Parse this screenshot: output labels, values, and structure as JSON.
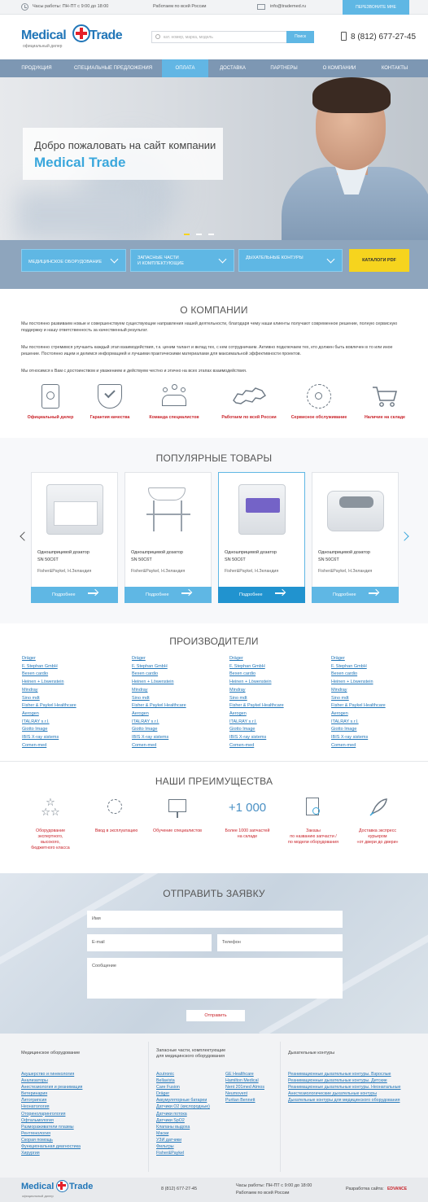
{
  "topbar": {
    "hours": "Часы работы: ПН-ПТ с 9:00 до 18:00",
    "region": "Работаем по всей России",
    "email": "info@trademed.ru",
    "callback": "Перезвоните мне"
  },
  "header": {
    "logo_word1": "Medical",
    "logo_word2": "Trade",
    "logo_sub": "официальный дилер",
    "search_placeholder": "кат. номер, марка, модель",
    "search_button": "Поиск",
    "phone": "8 (812) 677-27-45"
  },
  "nav": [
    "Продукция",
    "Специальные предложения",
    "Оплата",
    "Доставка",
    "Партнеры",
    "О компании",
    "Контакты"
  ],
  "hero": {
    "welcome": "Добро пожаловать на сайт компании",
    "company": "Medical Trade"
  },
  "categories": [
    {
      "line1": "Медицинское оборудование",
      "line2": ""
    },
    {
      "line1": "Запасные части",
      "line2": "и комплектующие"
    },
    {
      "line1": "Дыхательные контуры",
      "line2": ""
    }
  ],
  "catalog_pdf": "Каталоги PDF",
  "about": {
    "title": "О компании",
    "p1": "Мы постоянно развиваем новые и совершенствуем существующие направления нашей деятельности, благодаря чему наши клиенты получают современное решение, полную сервисную поддержку и нашу ответственность за качественный результат.",
    "p2": "Мы постоянно стремимся улучшить каждый этап взаимодействия, т.к. ценим талант и вклад тех, с кем сотрудничаем. Активно подключаем тех, кто должен быть вовлечен в то или иное решение. Постоянно ищем и делимся информацией и лучшими практическими материалами для максимальной эффективности проектов.",
    "p3": "Мы относимся к Вам с достоинством и уважением и действуем честно и этично на всех этапах взаимодействия."
  },
  "features": [
    "Официальный дилер",
    "Гарантия качества",
    "Команда специалистов",
    "Работаем по всей России",
    "Сервисное обслуживание",
    "Наличие на складе"
  ],
  "popular": {
    "title": "Популярные товары",
    "products": [
      {
        "name1": "Одношприцевой дозатор",
        "name2": "SN 50C6T",
        "brand": "Fisher&Paykel, Н.Зеландия",
        "more": "Подробнее"
      },
      {
        "name1": "Одношприцевой дозатор",
        "name2": "SN 50C6T",
        "brand": "Fisher&Paykel, Н.Зеландия",
        "more": "Подробнее"
      },
      {
        "name1": "Одношприцевой дозатор",
        "name2": "SN 50C6T",
        "brand": "Fisher&Paykel, Н.Зеландия",
        "more": "Подробнее"
      },
      {
        "name1": "Одношприцевой дозатор",
        "name2": "SN 50C6T",
        "brand": "Fisher&Paykel, Н.Зеландия",
        "more": "Подробнее"
      }
    ]
  },
  "manufacturers": {
    "title": "Производители",
    "columns": [
      [
        "Dräger",
        "F. Stephan GmbH",
        "Bexen cardio",
        "Heinen + Löwenstein",
        "Mindray",
        "Sino mdt",
        "Fisher & Paykel Healthcare",
        "Aerogen",
        "ITALRAY s.r.l.",
        "Giotto Image",
        "IBIS X-ray sistems",
        "Comen-med"
      ],
      [
        "Dräger",
        "F. Stephan GmbH",
        "Bexen cardio",
        "Heinen + Löwenstein",
        "Mindray",
        "Sino mdt",
        "Fisher & Paykel Healthcare",
        "Aerogen",
        "ITALRAY s.r.l.",
        "Giotto Image",
        "IBIS X-ray sistems",
        "Comen-med"
      ],
      [
        "Dräger",
        "F. Stephan GmbH",
        "Bexen cardio",
        "Heinen + Löwenstein",
        "Mindray",
        "Sino mdt",
        "Fisher & Paykel Healthcare",
        "Aerogen",
        "ITALRAY s.r.l.",
        "Giotto Image",
        "IBIS X-ray sistems",
        "Comen-med"
      ],
      [
        "Dräger",
        "F. Stephan GmbH",
        "Bexen cardio",
        "Heinen + Löwenstein",
        "Mindray",
        "Sino mdt",
        "Fisher & Paykel Healthcare",
        "Aerogen",
        "ITALRAY s.r.l.",
        "Giotto Image",
        "IBIS X-ray sistems",
        "Comen-med"
      ]
    ]
  },
  "advantages": {
    "title": "Наши преимущества",
    "big_number": "+1 000",
    "items": [
      [
        "Оборудование",
        "экспертного,",
        "высокого,",
        "бюджетного класса"
      ],
      [
        "Ввод в эксплуатацию"
      ],
      [
        "Обучение специалистов"
      ],
      [
        "Более 1000 запчастей",
        "на складе"
      ],
      [
        "Заказы",
        "по названию запчасти /",
        "по модели оборудования"
      ],
      [
        "Доставка экспресс",
        "курьером",
        "«от двери до двери»"
      ]
    ]
  },
  "form": {
    "title": "Отправить заявку",
    "name": "Имя",
    "email": "E-mail",
    "phone": "Телефон",
    "message": "Сообщение",
    "submit": "Отправить"
  },
  "footer": {
    "col1_title": "Медицинское оборудование",
    "col1": [
      "Акушерство и гинекология",
      "Анализаторы",
      "Анестезиология и реанимация",
      "Ветеринария",
      "Литотрипсия",
      "Неонатология",
      "Оториноларингология",
      "Офтальмология",
      "Размораживатели плазмы",
      "Рентгенология",
      "Скорая помощь",
      "Функциональная диагностика",
      "Хирургия"
    ],
    "col2_title1": "Запасные части, комплектующие",
    "col2_title2": "для медицинского оборудования",
    "col2a": [
      "Acutronic",
      "Bellavista",
      "Care Fusion",
      "Dräger",
      "Аккумуляторные батареи",
      "Датчики O2 (кислородные)",
      "Датчики потока",
      "Датчики SpO2",
      "Клапаны выдоха",
      "Маски",
      "УЗИ датчики",
      "Фильтры",
      "Fisher&Paykel"
    ],
    "col2b": [
      "GE Healthcare",
      "Hamilton Medical",
      "Nent 201med Atmos",
      "Neumovent",
      "Puritan Bennett"
    ],
    "col3_title": "Дыхательные контуры",
    "col3": [
      "Реанимационные дыхательные контуры. Взрослые",
      "Реанимационные дыхательные контуры. Детские",
      "Реанимационные дыхательные контуры. Неонатальные",
      "Анестезиологические дыхательные контуры",
      "Дыхательные контуры для медицинского оборудования"
    ],
    "phone": "8 (812) 677-27-45",
    "hours": "Часы работы: ПН-ПТ с 9:00 до 18:00",
    "region": "Работаем по всей России",
    "dev_label": "Разработка сайта:",
    "dev_brand": "EDVANCE"
  }
}
